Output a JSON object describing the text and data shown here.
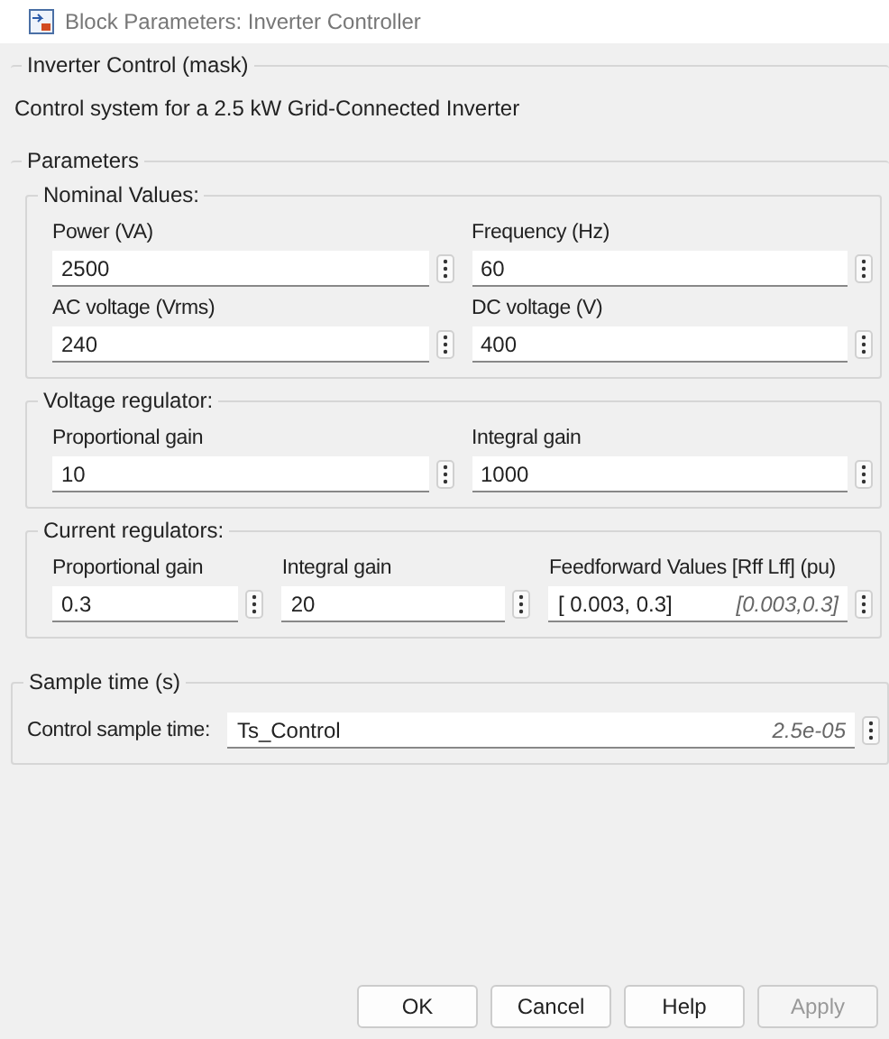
{
  "window": {
    "title": "Block Parameters: Inverter Controller"
  },
  "mask": {
    "title": "Inverter Control (mask)",
    "description": "Control system for a 2.5 kW Grid-Connected Inverter"
  },
  "parameters": {
    "title": "Parameters",
    "groups": [
      {
        "title": "Nominal Values:",
        "fields": [
          {
            "label": "Power (VA)",
            "value": "2500"
          },
          {
            "label": "Frequency (Hz)",
            "value": "60"
          },
          {
            "label": "AC voltage (Vrms)",
            "value": "240"
          },
          {
            "label": "DC voltage (V)",
            "value": "400"
          }
        ]
      },
      {
        "title": "Voltage regulator:",
        "fields": [
          {
            "label": "Proportional gain",
            "value": "10"
          },
          {
            "label": "Integral gain",
            "value": "1000"
          }
        ]
      },
      {
        "title": "Current regulators:",
        "fields": [
          {
            "label": "Proportional gain",
            "value": "0.3"
          },
          {
            "label": "Integral gain",
            "value": "20"
          },
          {
            "label": "Feedforward Values [Rff Lff] (pu)",
            "value": "[ 0.003, 0.3]",
            "evaluated": "[0.003,0.3]"
          }
        ]
      }
    ]
  },
  "sample_time": {
    "title": "Sample time (s)",
    "fields": [
      {
        "label": "Control sample time:",
        "value": "Ts_Control",
        "evaluated": "2.5e-05"
      }
    ]
  },
  "buttons": [
    {
      "label": "OK",
      "disabled": false
    },
    {
      "label": "Cancel",
      "disabled": false
    },
    {
      "label": "Help",
      "disabled": false
    },
    {
      "label": "Apply",
      "disabled": true
    }
  ]
}
